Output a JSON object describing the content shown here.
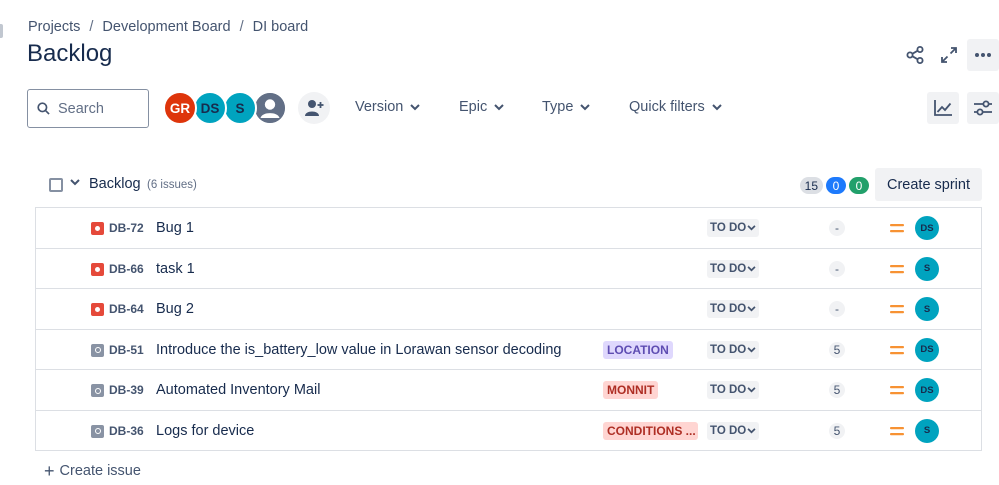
{
  "breadcrumb": {
    "items": [
      "Projects",
      "Development Board",
      "DI board"
    ],
    "separator": "/"
  },
  "page_title": "Backlog",
  "header_actions": [
    "share-icon",
    "expand-icon",
    "more-icon"
  ],
  "filters": {
    "search_placeholder": "Search",
    "avatars": [
      {
        "initials": "GR",
        "color": "#de350b"
      },
      {
        "initials": "DS",
        "color": "#00a3bf"
      },
      {
        "initials": "S",
        "color": "#00a3bf"
      },
      {
        "initials": "",
        "icon": "user-icon",
        "color": "#626f86"
      }
    ],
    "dropdowns": [
      "Version",
      "Epic",
      "Type",
      "Quick filters"
    ]
  },
  "backlog": {
    "title": "Backlog",
    "count_label": "(6 issues)",
    "counts": {
      "todo": "15",
      "in_progress": "0",
      "done": "0"
    },
    "create_sprint_label": "Create sprint",
    "issues": [
      {
        "type": "bug",
        "key": "DB-72",
        "summary": "Bug 1",
        "epic": "",
        "status": "TO DO",
        "estimate": "-",
        "priority": "medium",
        "assignee": "DS"
      },
      {
        "type": "bug",
        "key": "DB-66",
        "summary": "task 1",
        "epic": "",
        "status": "TO DO",
        "estimate": "-",
        "priority": "medium",
        "assignee": "S"
      },
      {
        "type": "bug",
        "key": "DB-64",
        "summary": "Bug 2",
        "epic": "",
        "status": "TO DO",
        "estimate": "-",
        "priority": "medium",
        "assignee": "S"
      },
      {
        "type": "task",
        "key": "DB-51",
        "summary": "Introduce the is_battery_low value in Lorawan sensor decoding",
        "epic": "LOCATION",
        "epic_color": "purple",
        "status": "TO DO",
        "estimate": "5",
        "priority": "medium",
        "assignee": "DS"
      },
      {
        "type": "task",
        "key": "DB-39",
        "summary": "Automated Inventory Mail",
        "epic": "MONNIT",
        "epic_color": "red",
        "status": "TO DO",
        "estimate": "5",
        "priority": "medium",
        "assignee": "DS"
      },
      {
        "type": "task",
        "key": "DB-36",
        "summary": "Logs for device",
        "epic": "CONDITIONS ...",
        "epic_color": "red",
        "status": "TO DO",
        "estimate": "5",
        "priority": "medium",
        "assignee": "S"
      }
    ],
    "create_issue_label": "Create issue"
  },
  "colors": {
    "bug": "#e5493a",
    "task": "#8993a4",
    "priority_medium": "#f79233",
    "accent_blue": "#1d7afc",
    "accent_green": "#22a06b"
  }
}
